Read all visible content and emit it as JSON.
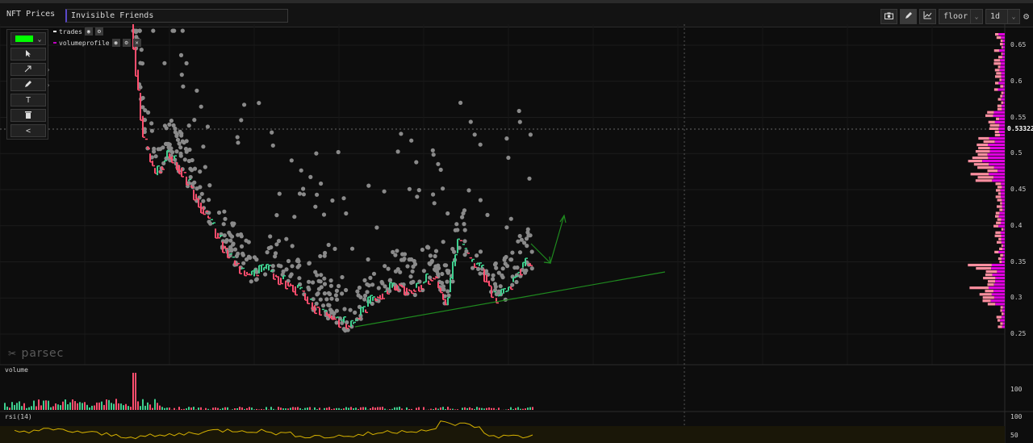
{
  "app": {
    "title": "NFT Prices"
  },
  "search": {
    "value": "Invisible Friends",
    "placeholder": ""
  },
  "toolbar": {
    "camera_icon": "camera-icon",
    "pencil_icon": "pencil-icon",
    "chart_icon": "line-chart-icon",
    "metric": "floor",
    "interval": "1d",
    "settings_icon": "gear-icon"
  },
  "tools": {
    "color": "#00ff00",
    "items": [
      "cursor-icon",
      "arrow-tool-icon",
      "brush-icon",
      "text-tool-icon",
      "trash-icon",
      "collapse-icon"
    ],
    "text_tool_label": "T",
    "collapse_label": "<"
  },
  "legend": [
    {
      "label": "trades",
      "color": "#ffffff"
    },
    {
      "label": "volumeprofile",
      "color": "#c000c0"
    }
  ],
  "watermark": "parsec",
  "price_axis": {
    "ticks": [
      "0.65",
      "0.6",
      "0.55",
      "0.5",
      "0.45",
      "0.4",
      "0.35",
      "0.3",
      "0.25"
    ],
    "current_price": "0.533220"
  },
  "volume_pane": {
    "label": "volume",
    "tick": "100"
  },
  "rsi_pane": {
    "label": "rsi(14)",
    "ticks": [
      "100",
      "50"
    ]
  },
  "colors": {
    "up": "#3ecf8e",
    "down": "#ff4d6d",
    "scatter": "#8a8a8a",
    "trendline": "#1f8a1f",
    "profile_buy": "#e000e0",
    "profile_sell": "#ff8fa0",
    "rsi": "#d4b000"
  },
  "chart_data": {
    "type": "line",
    "title": "",
    "series": [
      {
        "values": [
          0.68,
          0.52,
          0.47,
          0.5,
          0.48,
          0.45,
          0.42,
          0.39,
          0.36,
          0.34,
          0.33,
          0.34,
          0.33,
          0.32,
          0.31,
          0.29,
          0.28,
          0.27,
          0.26,
          0.28,
          0.3,
          0.31,
          0.32,
          0.31,
          0.32,
          0.33,
          0.29,
          0.38,
          0.35,
          0.34,
          0.3,
          0.31,
          0.34,
          0.35
        ]
      }
    ],
    "ylim": [
      0.24,
      0.67
    ]
  }
}
